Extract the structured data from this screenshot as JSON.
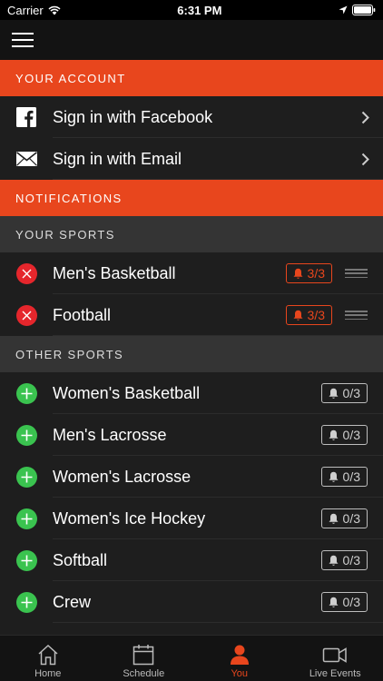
{
  "status_bar": {
    "carrier": "Carrier",
    "time": "6:31 PM"
  },
  "sections": {
    "account": "YOUR ACCOUNT",
    "notifications": "NOTIFICATIONS",
    "your_sports": "YOUR SPORTS",
    "other_sports": "OTHER SPORTS"
  },
  "account": {
    "facebook_label": "Sign in with Facebook",
    "email_label": "Sign in with Email"
  },
  "your_sports": [
    {
      "name": "Men's Basketball",
      "count": "3/3"
    },
    {
      "name": "Football",
      "count": "3/3"
    }
  ],
  "other_sports": [
    {
      "name": "Women's Basketball",
      "count": "0/3"
    },
    {
      "name": "Men's Lacrosse",
      "count": "0/3"
    },
    {
      "name": "Women's Lacrosse",
      "count": "0/3"
    },
    {
      "name": "Women's Ice Hockey",
      "count": "0/3"
    },
    {
      "name": "Softball",
      "count": "0/3"
    },
    {
      "name": "Crew",
      "count": "0/3"
    }
  ],
  "tabs": [
    {
      "label": "Home",
      "icon": "home-icon"
    },
    {
      "label": "Schedule",
      "icon": "calendar-icon"
    },
    {
      "label": "You",
      "icon": "person-icon"
    },
    {
      "label": "Live Events",
      "icon": "video-icon"
    }
  ],
  "colors": {
    "accent": "#e8461d",
    "remove": "#e5262c",
    "add": "#3ac34f"
  }
}
